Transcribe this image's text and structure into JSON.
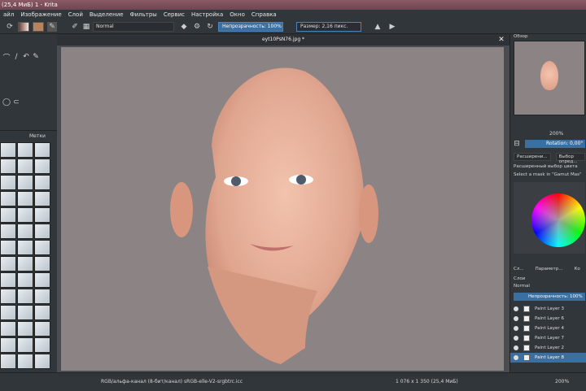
{
  "window": {
    "title": "(25,4 МиБ) 1 - Krita"
  },
  "menu": [
    "айл",
    "Изображение",
    "Слой",
    "Выделение",
    "Фильтры",
    "Сервис",
    "Настройка",
    "Окно",
    "Справка"
  ],
  "toolbar": {
    "blend_mode": "Normal",
    "opacity_label": "Непрозрачность: 100%",
    "size_label": "Размер: 2,16 пикс."
  },
  "brushes": {
    "tag_label": "Метки"
  },
  "canvas": {
    "tab_title": "eyt10PsN76.jpg *"
  },
  "right_panel": {
    "overview_label": "Обзор",
    "zoom": "200%",
    "rotation_label": "Rotation: 0,00°",
    "tabs": [
      "Расширени...",
      "Выбор опред..."
    ],
    "selection_label": "Расширенный выбор цвета",
    "select_mask": "Select a mask in \"Gamut Mas\"",
    "layers_tabs": [
      "Сл...",
      "Параметр...",
      "Ко"
    ],
    "layers_title": "Слои",
    "layers_mode": "Normal",
    "layers_opacity": "Непрозрачность: 100%",
    "layers": [
      "Paint Layer 3",
      "Paint Layer 6",
      "Paint Layer 4",
      "Paint Layer 7",
      "Paint Layer 2",
      "Paint Layer 8"
    ]
  },
  "status": {
    "color_info": "RGB/альфа-канал (8-бит/канал)  sRGB-elle-V2-srgbtrc.icc",
    "size_info": "1 076 x 1 350 (25,4 МиБ)",
    "zoom": "200%"
  }
}
